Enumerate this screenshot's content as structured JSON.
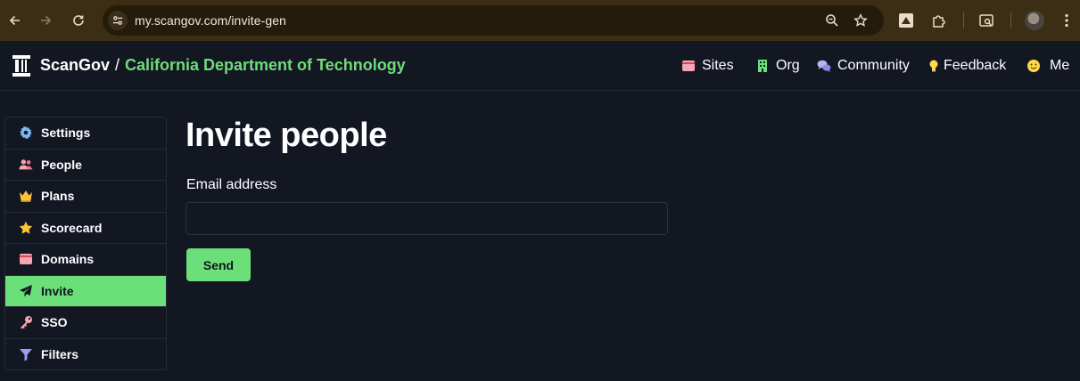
{
  "browser": {
    "url": "my.scangov.com/invite-gen",
    "icons": {
      "back": "arrow-left-icon",
      "forward": "arrow-right-icon",
      "reload": "reload-icon",
      "site_info": "tune-icon",
      "zoom": "zoom-icon",
      "bookmark": "star-icon",
      "extension1": "extension-icon",
      "extensions": "puzzle-icon",
      "reading": "reading-mode-icon",
      "menu": "kebab-menu-icon"
    }
  },
  "header": {
    "brand": "ScanGov",
    "separator": "/",
    "org": "California Department of Technology",
    "org_color": "#6fdc7a",
    "nav": [
      {
        "label": "Sites",
        "icon": "card-icon"
      },
      {
        "label": "Org",
        "icon": "building-icon"
      },
      {
        "label": "Community",
        "icon": "chat-bubbles-icon"
      },
      {
        "label": "Feedback",
        "icon": "lightbulb-icon"
      },
      {
        "label": "Me",
        "icon": "smiley-icon"
      }
    ]
  },
  "sidebar": {
    "items": [
      {
        "label": "Settings",
        "icon": "gear-icon",
        "active": false
      },
      {
        "label": "People",
        "icon": "people-icon",
        "active": false
      },
      {
        "label": "Plans",
        "icon": "crown-icon",
        "active": false
      },
      {
        "label": "Scorecard",
        "icon": "star-icon",
        "active": false
      },
      {
        "label": "Domains",
        "icon": "card-icon",
        "active": false
      },
      {
        "label": "Invite",
        "icon": "paper-plane-icon",
        "active": true
      },
      {
        "label": "SSO",
        "icon": "key-icon",
        "active": false
      },
      {
        "label": "Filters",
        "icon": "funnel-icon",
        "active": false
      }
    ]
  },
  "main": {
    "title": "Invite people",
    "email_label": "Email address",
    "email_value": "",
    "email_placeholder": "",
    "send_label": "Send"
  },
  "colors": {
    "accent": "#6be07a",
    "background": "#131722",
    "browser_frame": "#3b2e14"
  }
}
